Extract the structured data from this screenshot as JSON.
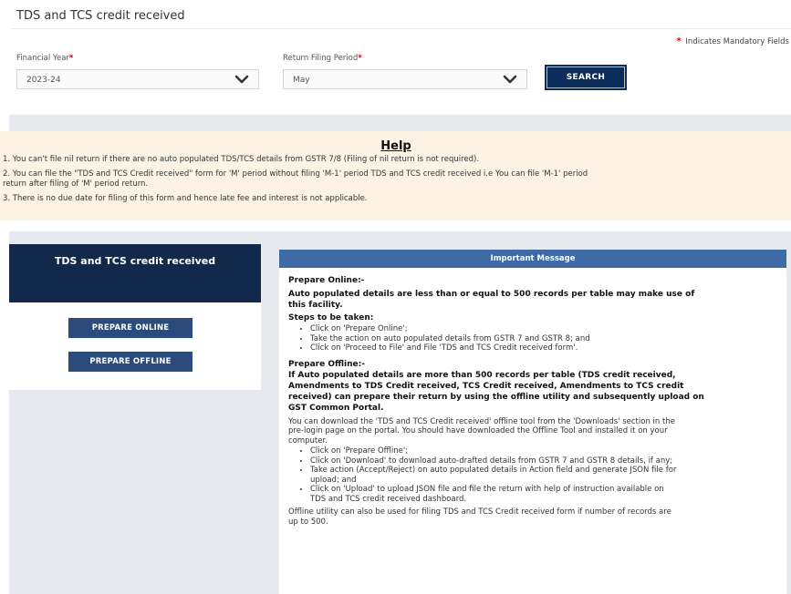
{
  "page": {
    "title": "TDS and TCS credit received",
    "mandatory_note": "Indicates Mandatory Fields"
  },
  "filters": {
    "financial_year": {
      "label": "Financial Year",
      "value": "2023-24"
    },
    "return_period": {
      "label": "Return Filing Period",
      "value": "May"
    },
    "search_label": "SEARCH"
  },
  "help": {
    "title": "Help",
    "items": [
      "1. You can't file nil return if there are no auto populated TDS/TCS details from GSTR 7/8 (Filing of nil return is not required).",
      "2. You can file the \"TDS and TCS Credit received\" form for 'M' period without filing 'M-1' period TDS and TCS credit received i.e You can file 'M-1' period",
      "return after filing of 'M' period return.",
      "3. There is no due date for filing of this form and hence late fee and interest is not applicable."
    ]
  },
  "left_panel": {
    "title": "TDS and TCS credit received",
    "prepare_online": "PREPARE ONLINE",
    "prepare_offline": "PREPARE OFFLINE"
  },
  "message": {
    "header": "Important Message",
    "online_title": "Prepare Online:-",
    "online_desc": [
      "Auto populated details are less than or equal to 500 records per table may make use of",
      "this facility."
    ],
    "steps_title": "Steps to be taken:",
    "online_steps": [
      "Click on 'Prepare Online';",
      "Take the action on auto populated details from GSTR 7 and GSTR 8; and",
      "Click on 'Proceed to File' and File 'TDS and TCS Credit received form'."
    ],
    "offline_title": "Prepare Offline:-",
    "offline_desc": [
      "If Auto populated details are more than 500 records per table (TDS credit received,",
      "Amendments to TDS Credit received, TCS Credit received, Amendments to TCS credit",
      "received) can prepare their return by using the offline utility and subsequently upload on",
      "GST Common Portal."
    ],
    "download_text": [
      "You can download the 'TDS and TCS Credit received' offline tool from the 'Downloads' section in the",
      "pre-login page on the portal. You should have downloaded the Offline Tool and installed it on your",
      "computer."
    ],
    "offline_steps": [
      [
        "Click on 'Prepare Offline';"
      ],
      [
        "Click on 'Download' to download auto-drafted details from GSTR 7 and GSTR 8 details, if any;"
      ],
      [
        "Take action (Accept/Reject) on auto populated details in Action field and generate JSON file for",
        "upload; and"
      ],
      [
        "Click on 'Upload' to upload JSON file and file the return with help of instruction available on",
        "TDS and TCS credit received dashboard."
      ]
    ],
    "footer": [
      "Offline utility can also be used for filing TDS and TCS Credit received form if number of records are",
      "up to 500."
    ]
  },
  "colors": {
    "primary": "#13294b",
    "button": "#2a4b7c",
    "header_blue": "#3e6ba5",
    "help_bg": "#fdf3e4",
    "required": "#d0021b"
  }
}
